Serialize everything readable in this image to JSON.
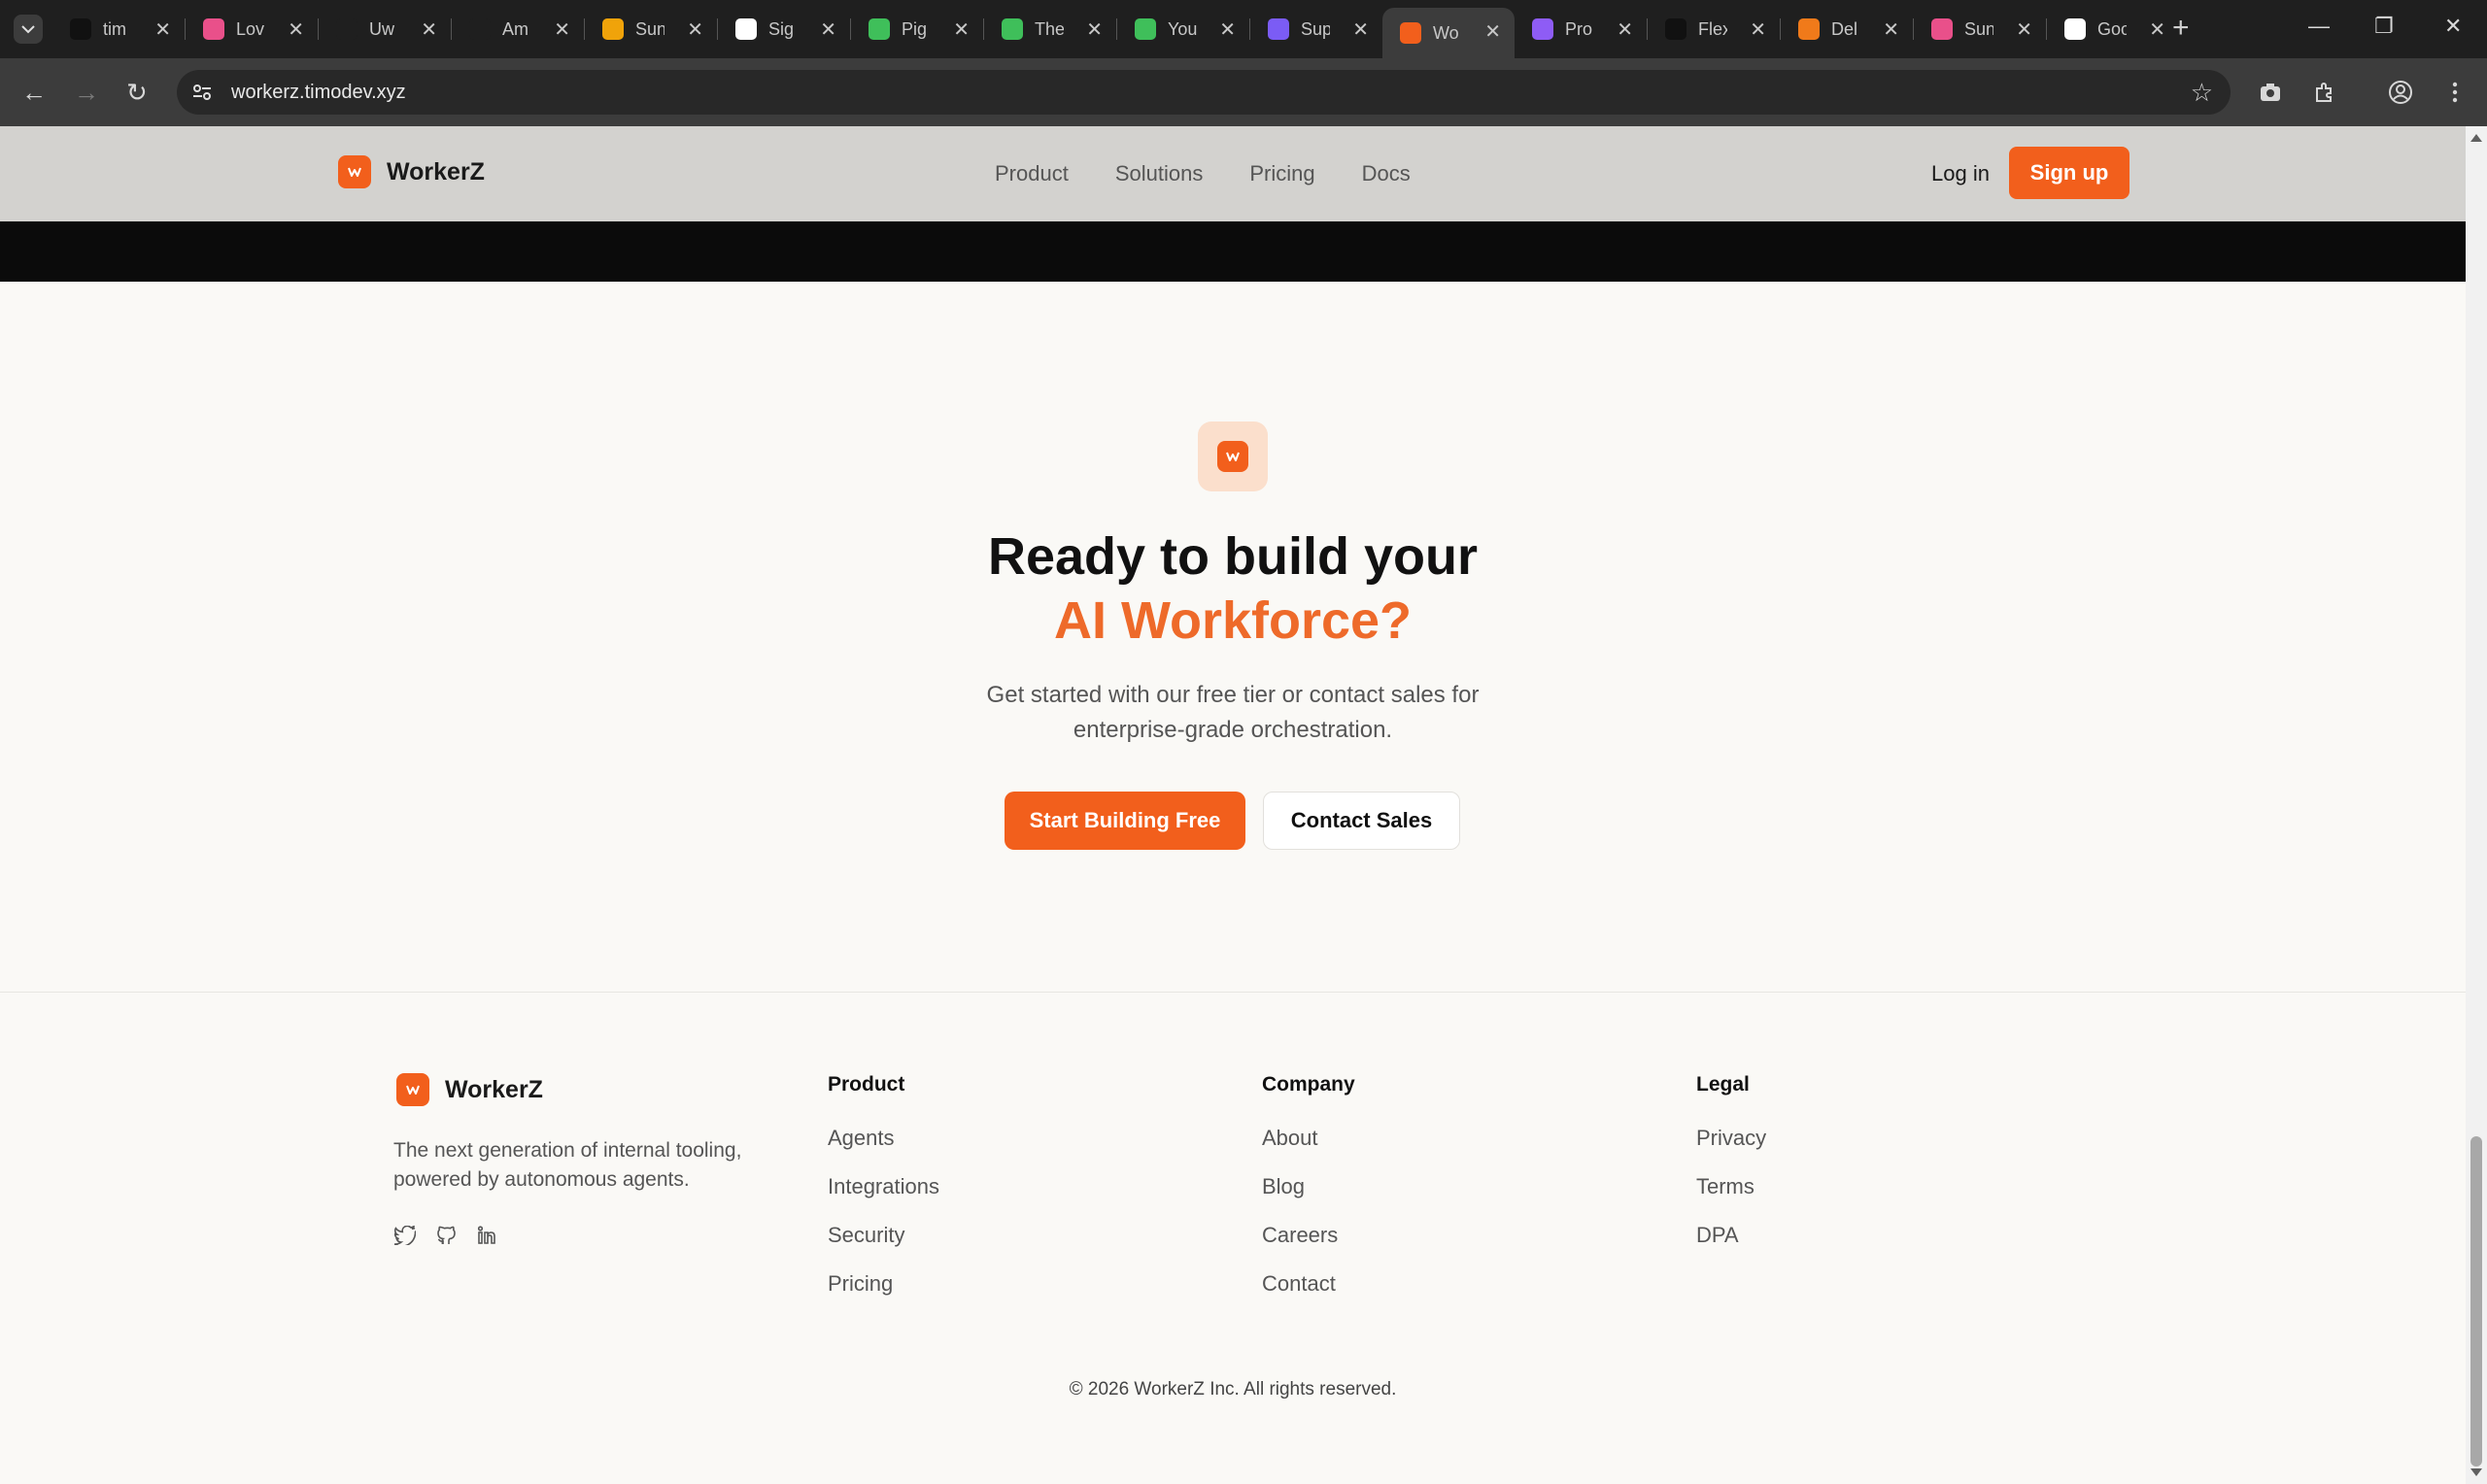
{
  "browser": {
    "tabs": [
      {
        "label": "tim",
        "favicon_color": "#111111"
      },
      {
        "label": "Lov",
        "favicon_color": "#e9508a"
      },
      {
        "label": "Uw",
        "favicon_color": "#1f1f1f"
      },
      {
        "label": "Am",
        "favicon_color": "#1f1f1f"
      },
      {
        "label": "Sun",
        "favicon_color": "#f0a30a"
      },
      {
        "label": "Sig",
        "favicon_color": "#ffffff"
      },
      {
        "label": "Pig",
        "favicon_color": "#3fbf5a"
      },
      {
        "label": "The",
        "favicon_color": "#3fbf5a"
      },
      {
        "label": "You",
        "favicon_color": "#3fbf5a"
      },
      {
        "label": "Sup",
        "favicon_color": "#7b5cf5"
      },
      {
        "label": "Wo",
        "favicon_color": "#f25f1c",
        "active": true
      },
      {
        "label": "Pro",
        "favicon_color": "#8e5cf5"
      },
      {
        "label": "Flex",
        "favicon_color": "#111111"
      },
      {
        "label": "Del",
        "favicon_color": "#f07a1a"
      },
      {
        "label": "Sun",
        "favicon_color": "#e9508a"
      },
      {
        "label": "Goo",
        "favicon_color": "#ffffff"
      }
    ],
    "url": "workerz.timodev.xyz"
  },
  "header": {
    "brand": "WorkerZ",
    "nav": [
      "Product",
      "Solutions",
      "Pricing",
      "Docs"
    ],
    "login": "Log in",
    "signup": "Sign up"
  },
  "cta": {
    "title_line1": "Ready to build your",
    "title_line2": "AI Workforce?",
    "subtitle": "Get started with our free tier or contact sales for enterprise-grade orchestration.",
    "primary_button": "Start Building Free",
    "secondary_button": "Contact Sales"
  },
  "footer": {
    "brand": "WorkerZ",
    "tagline": "The next generation of internal tooling, powered by autonomous agents.",
    "socials": [
      "twitter-icon",
      "github-icon",
      "linkedin-icon"
    ],
    "columns": [
      {
        "title": "Product",
        "links": [
          "Agents",
          "Integrations",
          "Security",
          "Pricing"
        ]
      },
      {
        "title": "Company",
        "links": [
          "About",
          "Blog",
          "Careers",
          "Contact"
        ]
      },
      {
        "title": "Legal",
        "links": [
          "Privacy",
          "Terms",
          "DPA"
        ]
      }
    ],
    "copyright": "© 2026 WorkerZ Inc. All rights reserved."
  },
  "colors": {
    "accent": "#f25f1c",
    "accent_text": "#ee6a2a",
    "header_bg": "#d3d2cf",
    "page_bg": "#faf9f6"
  }
}
